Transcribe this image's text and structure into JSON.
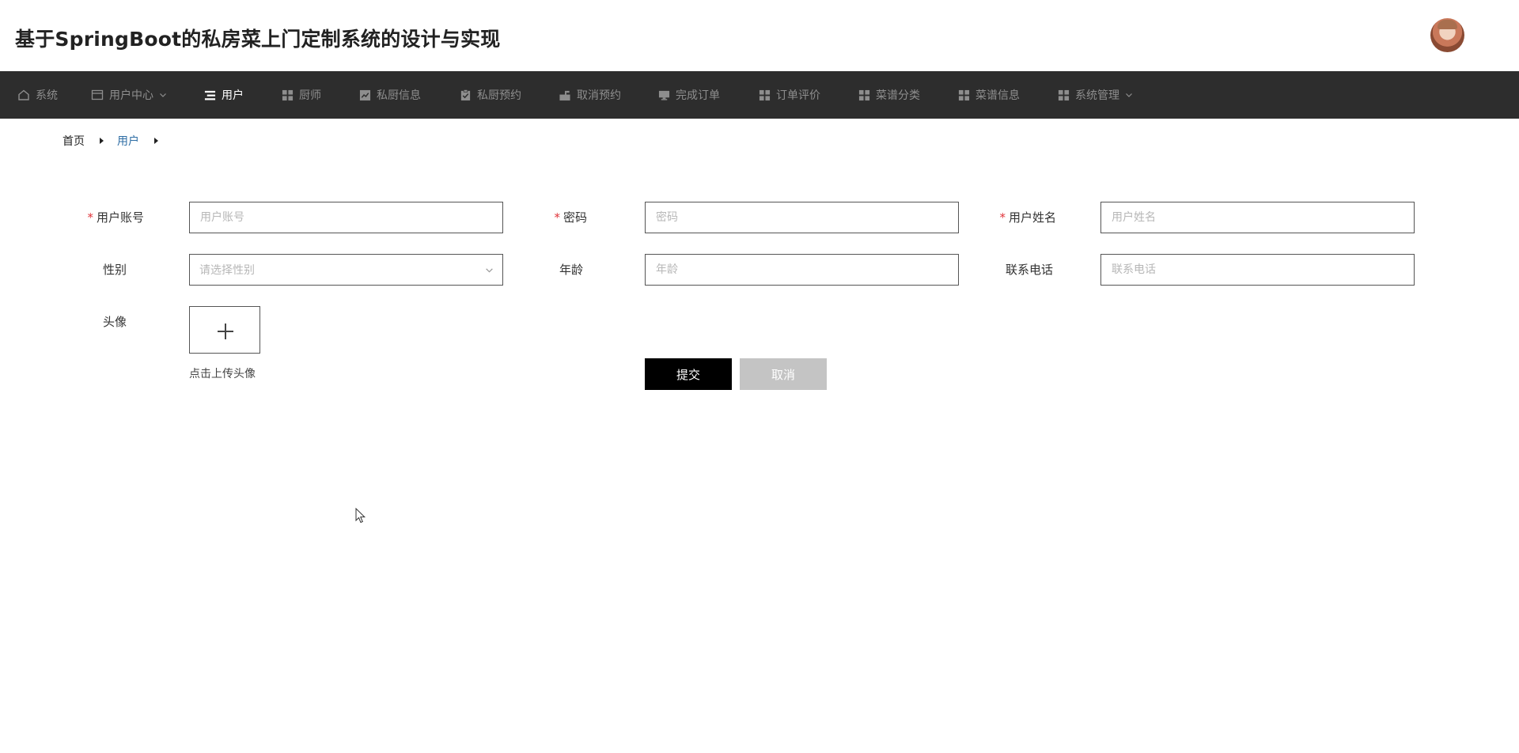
{
  "header": {
    "title": "基于SpringBoot的私房菜上门定制系统的设计与实现"
  },
  "nav": {
    "items": [
      {
        "label": "系统",
        "icon": "home-icon",
        "active": false
      },
      {
        "label": "用户中心",
        "icon": "card-icon",
        "active": false,
        "has_dropdown": true
      },
      {
        "label": "用户",
        "icon": "list-icon",
        "active": true
      },
      {
        "label": "厨师",
        "icon": "grid-icon",
        "active": false
      },
      {
        "label": "私厨信息",
        "icon": "chart-icon",
        "active": false
      },
      {
        "label": "私厨预约",
        "icon": "clipboard-check-icon",
        "active": false
      },
      {
        "label": "取消预约",
        "icon": "mailbox-icon",
        "active": false
      },
      {
        "label": "完成订单",
        "icon": "monitor-icon",
        "active": false
      },
      {
        "label": "订单评价",
        "icon": "grid-icon",
        "active": false
      },
      {
        "label": "菜谱分类",
        "icon": "grid-icon",
        "active": false
      },
      {
        "label": "菜谱信息",
        "icon": "grid-icon",
        "active": false
      },
      {
        "label": "系统管理",
        "icon": "grid-icon",
        "active": false,
        "has_dropdown": true
      }
    ]
  },
  "breadcrumb": {
    "home": "首页",
    "current": "用户"
  },
  "form": {
    "username": {
      "label": "用户账号",
      "placeholder": "用户账号",
      "required": true
    },
    "password": {
      "label": "密码",
      "placeholder": "密码",
      "required": true
    },
    "realname": {
      "label": "用户姓名",
      "placeholder": "用户姓名",
      "required": true
    },
    "gender": {
      "label": "性别",
      "placeholder": "请选择性别"
    },
    "age": {
      "label": "年龄",
      "placeholder": "年龄"
    },
    "phone": {
      "label": "联系电话",
      "placeholder": "联系电话"
    },
    "avatar": {
      "label": "头像",
      "hint": "点击上传头像"
    },
    "required_mark": "*"
  },
  "actions": {
    "submit": "提交",
    "cancel": "取消"
  },
  "colors": {
    "nav_bg": "#2d2d2d",
    "nav_active": "#ffffff",
    "nav_inactive": "#8e8e8e",
    "breadcrumb_current": "#2f6ea5",
    "required": "#e0343a",
    "submit_bg": "#000000",
    "cancel_bg": "#c4c4c4"
  }
}
